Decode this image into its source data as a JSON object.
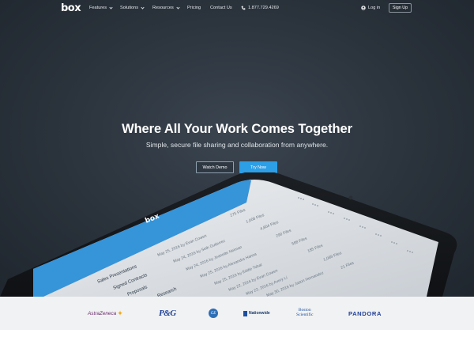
{
  "nav": {
    "logo": "box",
    "items": [
      {
        "label": "Features",
        "dropdown": true
      },
      {
        "label": "Solutions",
        "dropdown": true
      },
      {
        "label": "Resources",
        "dropdown": true
      },
      {
        "label": "Pricing",
        "dropdown": false
      },
      {
        "label": "Contact Us",
        "dropdown": false
      }
    ],
    "phone": "1.877.729.4269",
    "login": "Log in",
    "signup": "Sign Up"
  },
  "hero": {
    "headline": "Where All Your Work Comes Together",
    "subhead": "Simple, secure file sharing and collaboration from anywhere.",
    "watch_demo": "Watch Demo",
    "try_now": "Try Now"
  },
  "tablet": {
    "app_logo": "box",
    "folders": [
      "Sales Presentations",
      "Signed Contracts",
      "Proposals",
      "Research"
    ],
    "updates": [
      "May 25, 2016 by Evan Cowen",
      "May 24, 2016 by Seth Gutierrez",
      "May 24, 2016 by Jeanette Neiman",
      "May 25, 2016 by Alexandra Hanna",
      "May 25, 2016 by Eddie Tobat",
      "May 22, 2016 by Evan Cowen",
      "May 22, 2016 by Avery Li",
      "May 30, 2016 by Jason Hernandez"
    ],
    "counts": [
      "275 Files",
      "1,008 Files",
      "4,804 Files",
      "290 Files",
      "588 Files",
      "185 Files",
      "1,089 Files",
      "21 Files"
    ]
  },
  "clients": {
    "astrazeneca": "AstraZeneca",
    "pg": "P&G",
    "ge": "GE",
    "nationwide": "Nationwide",
    "boston1": "Boston",
    "boston2": "Scientific",
    "pandora": "PANDORA"
  },
  "colors": {
    "hero_bg": "#2a323b",
    "accent_blue": "#2d9fe6",
    "logo_strip_bg": "#f1f2f3"
  }
}
